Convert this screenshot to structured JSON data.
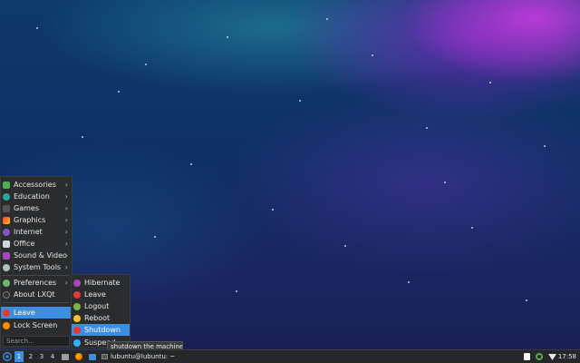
{
  "desktop": {
    "accent_color": "#3d8ee0"
  },
  "main_menu": {
    "items": [
      {
        "label": "Accessories",
        "icon": "accessories-icon",
        "has_submenu": true
      },
      {
        "label": "Education",
        "icon": "education-icon",
        "has_submenu": true
      },
      {
        "label": "Games",
        "icon": "games-icon",
        "has_submenu": true
      },
      {
        "label": "Graphics",
        "icon": "graphics-icon",
        "has_submenu": true
      },
      {
        "label": "Internet",
        "icon": "internet-icon",
        "has_submenu": true
      },
      {
        "label": "Office",
        "icon": "office-icon",
        "has_submenu": true
      },
      {
        "label": "Sound & Video",
        "icon": "sound-video-icon",
        "has_submenu": true
      },
      {
        "label": "System Tools",
        "icon": "system-tools-icon",
        "has_submenu": true
      }
    ],
    "items2": [
      {
        "label": "Preferences",
        "icon": "preferences-icon",
        "has_submenu": true
      },
      {
        "label": "About LXQt",
        "icon": "about-icon",
        "has_submenu": false
      }
    ],
    "items3": [
      {
        "label": "Leave",
        "icon": "leave-icon",
        "has_submenu": true,
        "active": true
      },
      {
        "label": "Lock Screen",
        "icon": "lock-screen-icon",
        "has_submenu": false
      }
    ],
    "search_placeholder": "Search..."
  },
  "leave_menu": {
    "items": [
      {
        "label": "Hibernate",
        "icon": "hibernate-icon"
      },
      {
        "label": "Leave",
        "icon": "leave-icon"
      },
      {
        "label": "Logout",
        "icon": "logout-icon"
      },
      {
        "label": "Reboot",
        "icon": "reboot-icon"
      },
      {
        "label": "Shutdown",
        "icon": "shutdown-icon",
        "active": true
      },
      {
        "label": "Suspend",
        "icon": "suspend-icon"
      }
    ]
  },
  "tooltip": {
    "text": "shutdown the machine"
  },
  "taskbar": {
    "desktops": [
      "1",
      "2",
      "3",
      "4"
    ],
    "current_desktop": "1",
    "task_label": "lubuntu@lubuntu: ~",
    "clock": "17:58"
  }
}
